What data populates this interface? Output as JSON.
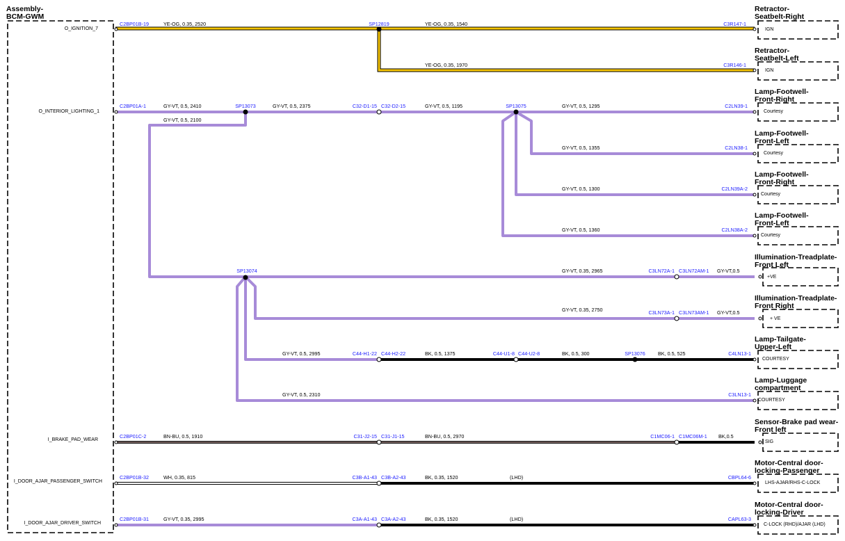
{
  "module": {
    "title_line1": "Assembly-",
    "title_line2": "BCM-GWM",
    "outputs": [
      "O_IGNITION_7",
      "O_INTERIOR_LIGHTING_1",
      "I_BRAKE_PAD_WEAR",
      "I_DOOR_AJAR_PASSENGER_SWITCH",
      "I_DOOR_AJAR_DRIVER_SWITCH"
    ]
  },
  "components": [
    {
      "line1": "Retractor-",
      "line2": "Seatbelt-Right",
      "pin": "IGN"
    },
    {
      "line1": "Retractor-",
      "line2": "Seatbelt-Left",
      "pin": "IGN"
    },
    {
      "line1": "Lamp-Footwell-",
      "line2": "Front-Right",
      "pin": "Courtesy"
    },
    {
      "line1": "Lamp-Footwell-",
      "line2": "Front-Left",
      "pin": "Courtesy"
    },
    {
      "line1": "Lamp-Footwell-",
      "line2": "Front-Right",
      "pin": "Courtesy"
    },
    {
      "line1": "Lamp-Footwell-",
      "line2": "Front-Left",
      "pin": "Courtesy"
    },
    {
      "line1": "Illumination-Treadplate-",
      "line2": "Front Left",
      "pin": "+VE"
    },
    {
      "line1": "Illumination-Treadplate-",
      "line2": "Front Right",
      "pin": "+ VE"
    },
    {
      "line1": "Lamp-Tailgate-",
      "line2": "Upper-Left",
      "pin": "COURTESY"
    },
    {
      "line1": "Lamp-Luggage",
      "line2": "compartment",
      "pin": "COURTESY"
    },
    {
      "line1": "Sensor-Brake pad wear-",
      "line2": "Front left",
      "pin": "SIG"
    },
    {
      "line1": "Motor-Central door-",
      "line2": "locking-Passenger",
      "pin": "LHS-AJAR/RHS-C-LOCK"
    },
    {
      "line1": "Motor-Central door-",
      "line2": "locking-Driver",
      "pin": "C-LOCK (RHD)/AJAR (LHD)"
    }
  ],
  "connectors": {
    "c2bp01b19": "C2BP01B-19",
    "sp12819": "SP12819",
    "c3r1471": "C3R147-1",
    "c3r1461": "C3R146-1",
    "c2bp01a1": "C2BP01A-1",
    "sp13073": "SP13073",
    "c32d115": "C32-D1-15",
    "c32d215": "C32-D2-15",
    "sp13075": "SP13075",
    "c2ln391": "C2LN39-1",
    "c2ln381": "C2LN38-1",
    "c2ln39a2": "C2LN39A-2",
    "c2ln38a2": "C2LN38A-2",
    "sp13074": "SP13074",
    "c3ln72a1": "C3LN72A-1",
    "c3ln72am1": "C3LN72AM-1",
    "c3ln73a1": "C3LN73A-1",
    "c3ln73am1": "C3LN73AM-1",
    "c44h122": "C44-H1-22",
    "c44h222": "C44-H2-22",
    "c44u18": "C44-U1-8",
    "c44u28": "C44-U2-8",
    "sp13076": "SP13076",
    "c4ln131": "C4LN13-1",
    "c3ln131": "C3LN13-1",
    "c2bp01c2": "C2BP01C-2",
    "c31j215": "C31-J2-15",
    "c31j115": "C31-J1-15",
    "c1mc061": "C1MC06-1",
    "c1mc06m1": "C1MC06M-1",
    "c2bp01b32": "C2BP01B-32",
    "c3ba143": "C3B-A1-43",
    "c3ba243": "C3B-A2-43",
    "cbpl646": "CBPL64-6",
    "c2bp01b31": "C2BP01B-31",
    "c3aa143": "C3A-A1-43",
    "c3aa243": "C3A-A2-43",
    "capl633": "CAPL63-3"
  },
  "wires": {
    "w1": "YE-OG,  0.35,  2520",
    "w2": "YE-OG,  0.35,  1540",
    "w3": "YE-OG,  0.35,  1970",
    "w4": "GY-VT,  0.5,  2410",
    "w5": "GY-VT,  0.5,  2375",
    "w6": "GY-VT,  0.5,  2100",
    "w7": "GY-VT,  0.5,  1195",
    "w8": "GY-VT,  0.5,  1295",
    "w9": "GY-VT,  0.5,  1355",
    "w10": "GY-VT,  0.5,  1300",
    "w11": "GY-VT,  0.5,  1360",
    "w12": "GY-VT,  0.35,  2965",
    "w12b": "GY-VT,0.5",
    "w13": "GY-VT,  0.35,  2750",
    "w13b": "GY-VT,0.5",
    "w14": "GY-VT,  0.5,  2995",
    "w15": "BK,  0.5,  1375",
    "w16": "BK,  0.5,  300",
    "w17": "BK,  0.5,  525",
    "w18": "GY-VT,  0.5,  2310",
    "w19": "BN-BU,  0.5,  1910",
    "w20": "BN-BU,  0.5,  2970",
    "w20b": "BK,0.5",
    "w21": "WH,  0.35,  815",
    "w22": "BK,  0.35,  1520",
    "w22b": "(LHD)",
    "w23": "GY-VT,  0.35,  2995",
    "w24": "BK,  0.35,  1520",
    "w24b": "(LHD)"
  },
  "colors": {
    "yellow": "#f5c400",
    "violet": "#a78bd8",
    "connector_text": "#1a1aff",
    "black": "#000000",
    "brown_blue": "#6f5a58",
    "white_wire": "#ffffff"
  }
}
